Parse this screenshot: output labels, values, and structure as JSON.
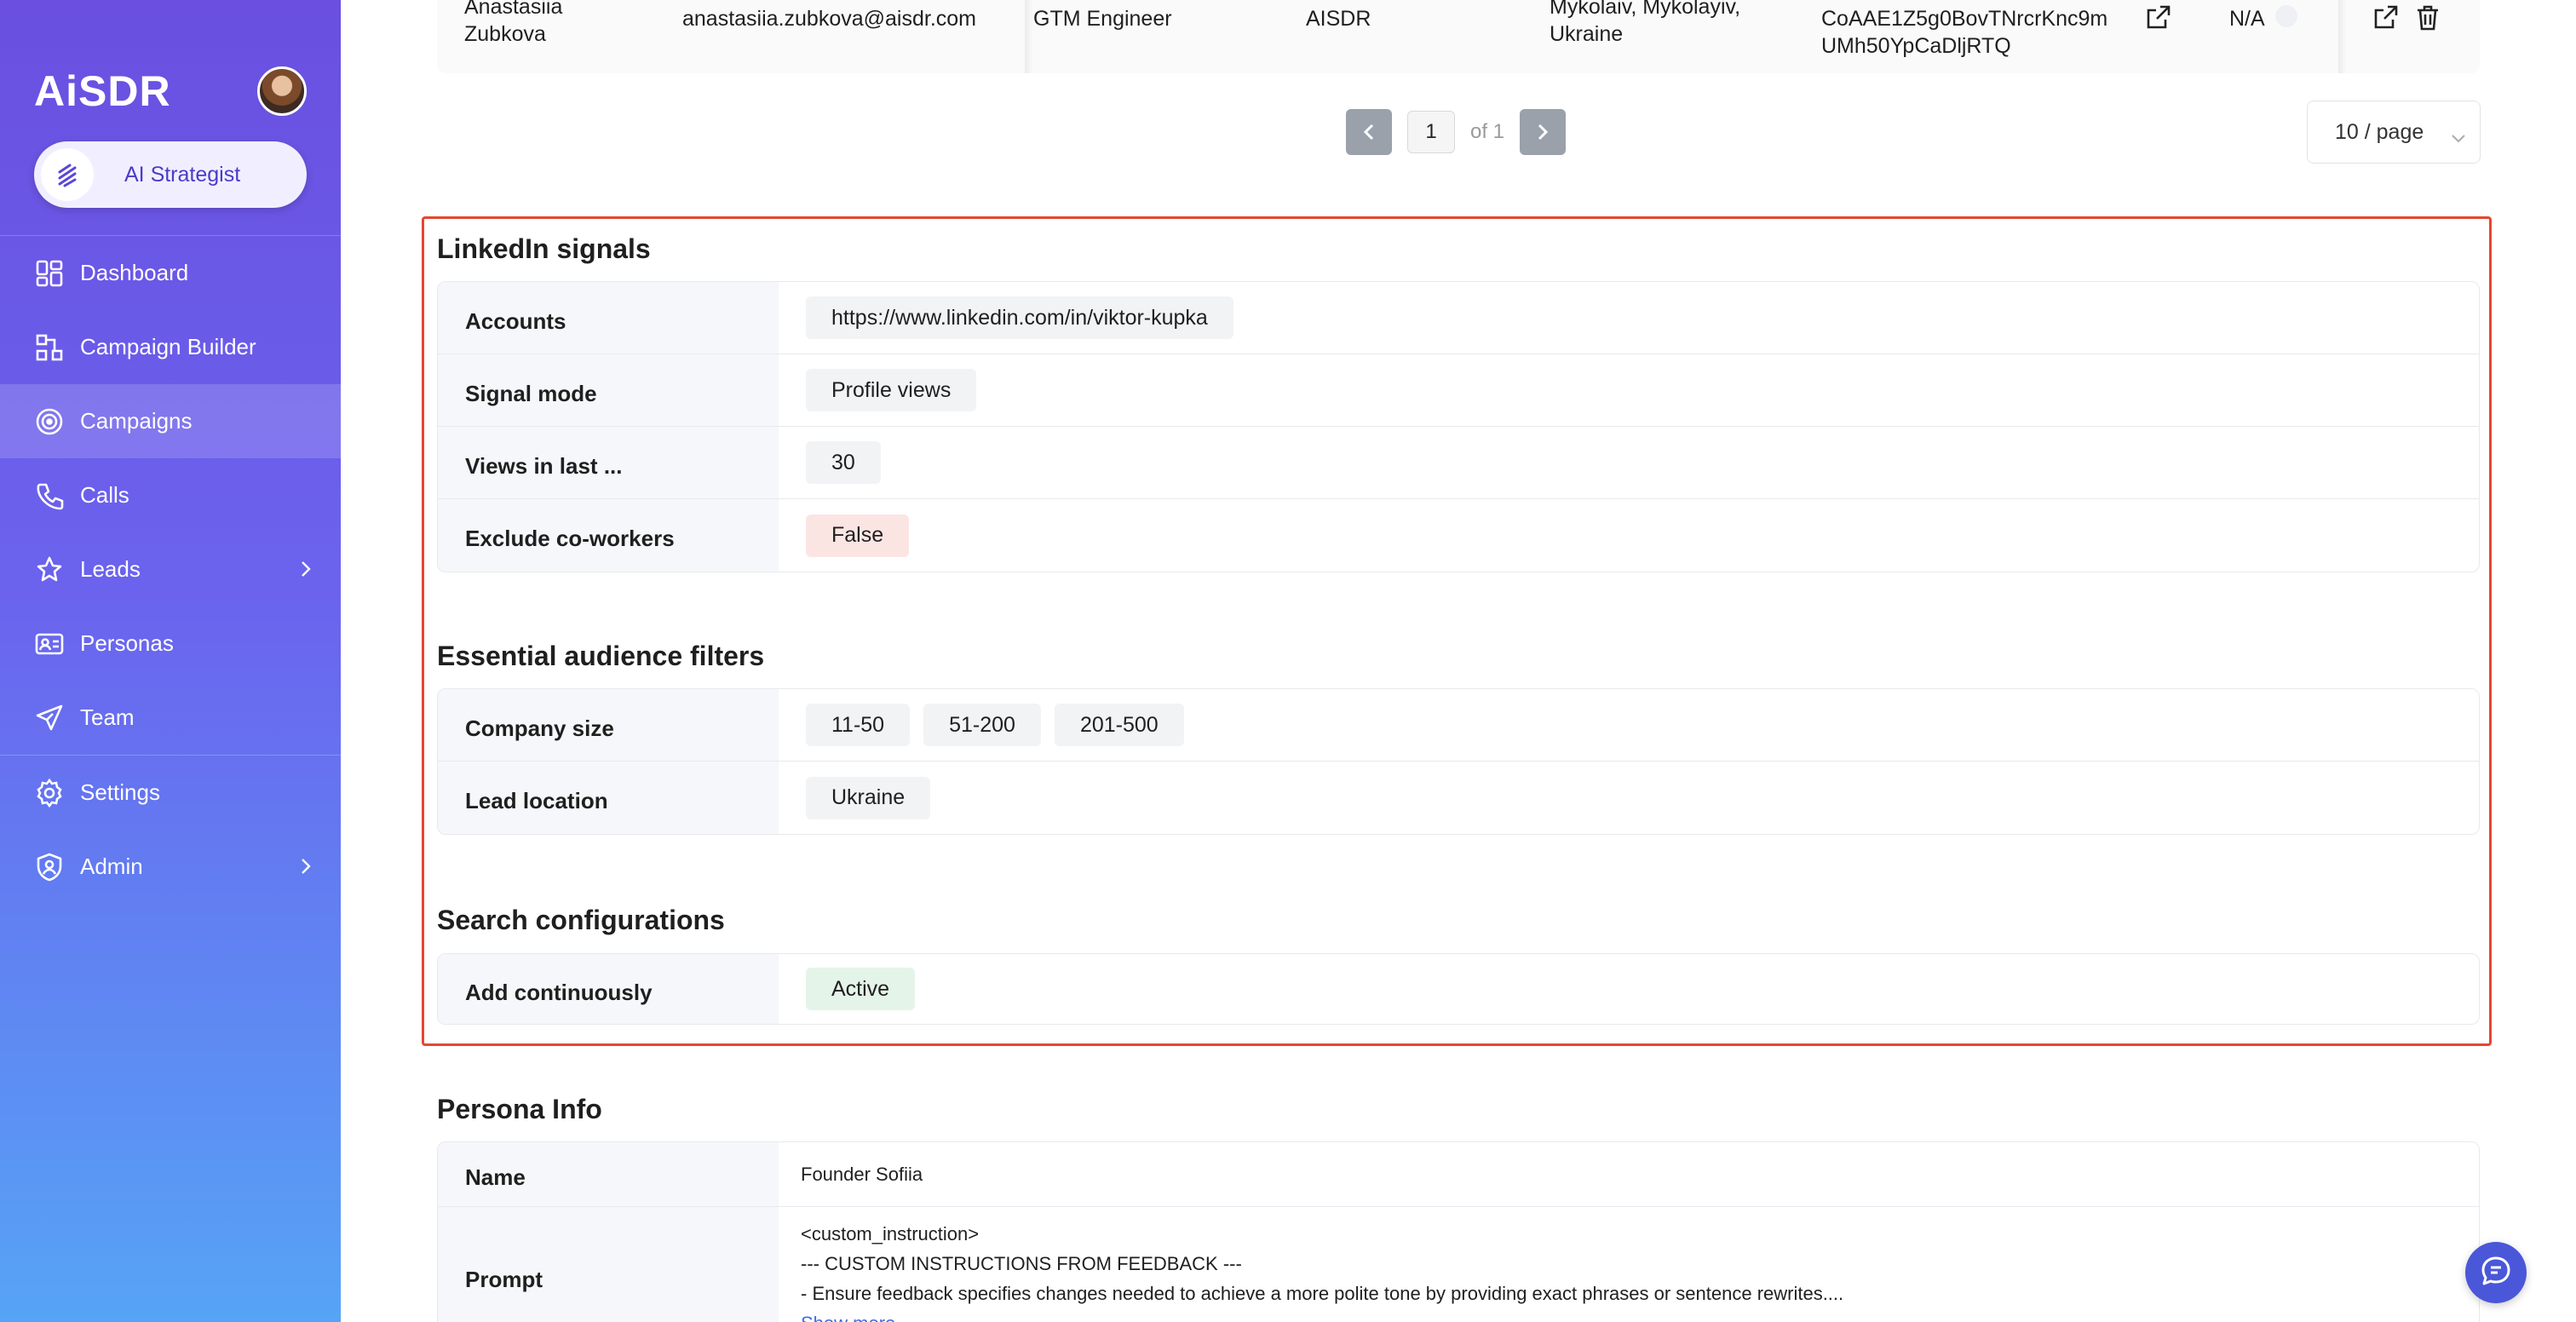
{
  "sidebar": {
    "brand": "AiSDR",
    "strategist_label": "AI Strategist",
    "items": [
      {
        "label": "Dashboard",
        "icon": "dashboard-icon"
      },
      {
        "label": "Campaign Builder",
        "icon": "campaign-builder-icon"
      },
      {
        "label": "Campaigns",
        "icon": "target-icon",
        "active": true
      },
      {
        "label": "Calls",
        "icon": "phone-icon"
      },
      {
        "label": "Leads",
        "icon": "star-person-icon",
        "has_submenu": true
      },
      {
        "label": "Personas",
        "icon": "id-card-icon"
      },
      {
        "label": "Team",
        "icon": "paper-plane-icon"
      },
      {
        "label": "Settings",
        "icon": "gear-icon"
      },
      {
        "label": "Admin",
        "icon": "shield-user-icon",
        "has_submenu": true
      }
    ]
  },
  "leads_table": {
    "row": {
      "name": [
        "Anastasiia",
        "Zubkova"
      ],
      "email": "anastasiia.zubkova@aisdr.com",
      "title": "GTM Engineer",
      "company": "AISDR",
      "location": [
        "Mykolaiv, Mykolayiv,",
        "Ukraine"
      ],
      "linkedin_id": [
        "CoAAE1Z5g0BovTNrcrKnc9m",
        "UMh50YpCaDljRTQ"
      ],
      "phone": "N/A"
    }
  },
  "pagination": {
    "current": "1",
    "of_label": "of 1",
    "per_page": "10 / page"
  },
  "linkedin_signals": {
    "title": "LinkedIn signals",
    "rows": [
      {
        "key": "Accounts",
        "values": [
          "https://www.linkedin.com/in/viktor-kupka"
        ]
      },
      {
        "key": "Signal mode",
        "values": [
          "Profile views"
        ]
      },
      {
        "key": "Views in last ...",
        "values": [
          "30"
        ]
      },
      {
        "key": "Exclude co-workers",
        "values": [
          "False"
        ]
      }
    ]
  },
  "audience_filters": {
    "title": "Essential audience filters",
    "rows": [
      {
        "key": "Company size",
        "values": [
          "11-50",
          "51-200",
          "201-500"
        ]
      },
      {
        "key": "Lead location",
        "values": [
          "Ukraine"
        ]
      }
    ]
  },
  "search_config": {
    "title": "Search configurations",
    "rows": [
      {
        "key": "Add continuously",
        "values": [
          "Active"
        ]
      }
    ]
  },
  "persona_info": {
    "title": "Persona Info",
    "name_key": "Name",
    "name_value": "Founder Sofiia",
    "prompt_key": "Prompt",
    "prompt_lines": [
      "<custom_instruction>",
      "--- CUSTOM INSTRUCTIONS FROM FEEDBACK ---",
      "- Ensure feedback specifies changes needed to achieve a more polite tone by providing exact phrases or sentence rewrites...."
    ],
    "show_more": "Show more"
  },
  "colors": {
    "highlight_border": "#e5472f",
    "false_tag": "#fbe5e3",
    "active_tag": "#e5f4e8",
    "sidebar_top": "#6a4fe0",
    "sidebar_bottom": "#56a4f6"
  }
}
